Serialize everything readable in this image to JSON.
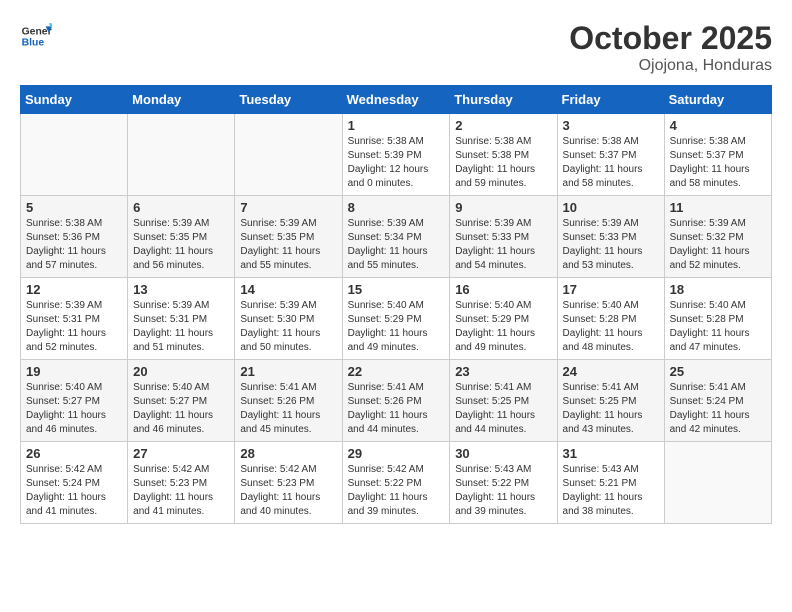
{
  "header": {
    "logo_line1": "General",
    "logo_line2": "Blue",
    "month": "October 2025",
    "location": "Ojojona, Honduras"
  },
  "days_of_week": [
    "Sunday",
    "Monday",
    "Tuesday",
    "Wednesday",
    "Thursday",
    "Friday",
    "Saturday"
  ],
  "weeks": [
    [
      {
        "day": "",
        "info": ""
      },
      {
        "day": "",
        "info": ""
      },
      {
        "day": "",
        "info": ""
      },
      {
        "day": "1",
        "info": "Sunrise: 5:38 AM\nSunset: 5:39 PM\nDaylight: 12 hours\nand 0 minutes."
      },
      {
        "day": "2",
        "info": "Sunrise: 5:38 AM\nSunset: 5:38 PM\nDaylight: 11 hours\nand 59 minutes."
      },
      {
        "day": "3",
        "info": "Sunrise: 5:38 AM\nSunset: 5:37 PM\nDaylight: 11 hours\nand 58 minutes."
      },
      {
        "day": "4",
        "info": "Sunrise: 5:38 AM\nSunset: 5:37 PM\nDaylight: 11 hours\nand 58 minutes."
      }
    ],
    [
      {
        "day": "5",
        "info": "Sunrise: 5:38 AM\nSunset: 5:36 PM\nDaylight: 11 hours\nand 57 minutes."
      },
      {
        "day": "6",
        "info": "Sunrise: 5:39 AM\nSunset: 5:35 PM\nDaylight: 11 hours\nand 56 minutes."
      },
      {
        "day": "7",
        "info": "Sunrise: 5:39 AM\nSunset: 5:35 PM\nDaylight: 11 hours\nand 55 minutes."
      },
      {
        "day": "8",
        "info": "Sunrise: 5:39 AM\nSunset: 5:34 PM\nDaylight: 11 hours\nand 55 minutes."
      },
      {
        "day": "9",
        "info": "Sunrise: 5:39 AM\nSunset: 5:33 PM\nDaylight: 11 hours\nand 54 minutes."
      },
      {
        "day": "10",
        "info": "Sunrise: 5:39 AM\nSunset: 5:33 PM\nDaylight: 11 hours\nand 53 minutes."
      },
      {
        "day": "11",
        "info": "Sunrise: 5:39 AM\nSunset: 5:32 PM\nDaylight: 11 hours\nand 52 minutes."
      }
    ],
    [
      {
        "day": "12",
        "info": "Sunrise: 5:39 AM\nSunset: 5:31 PM\nDaylight: 11 hours\nand 52 minutes."
      },
      {
        "day": "13",
        "info": "Sunrise: 5:39 AM\nSunset: 5:31 PM\nDaylight: 11 hours\nand 51 minutes."
      },
      {
        "day": "14",
        "info": "Sunrise: 5:39 AM\nSunset: 5:30 PM\nDaylight: 11 hours\nand 50 minutes."
      },
      {
        "day": "15",
        "info": "Sunrise: 5:40 AM\nSunset: 5:29 PM\nDaylight: 11 hours\nand 49 minutes."
      },
      {
        "day": "16",
        "info": "Sunrise: 5:40 AM\nSunset: 5:29 PM\nDaylight: 11 hours\nand 49 minutes."
      },
      {
        "day": "17",
        "info": "Sunrise: 5:40 AM\nSunset: 5:28 PM\nDaylight: 11 hours\nand 48 minutes."
      },
      {
        "day": "18",
        "info": "Sunrise: 5:40 AM\nSunset: 5:28 PM\nDaylight: 11 hours\nand 47 minutes."
      }
    ],
    [
      {
        "day": "19",
        "info": "Sunrise: 5:40 AM\nSunset: 5:27 PM\nDaylight: 11 hours\nand 46 minutes."
      },
      {
        "day": "20",
        "info": "Sunrise: 5:40 AM\nSunset: 5:27 PM\nDaylight: 11 hours\nand 46 minutes."
      },
      {
        "day": "21",
        "info": "Sunrise: 5:41 AM\nSunset: 5:26 PM\nDaylight: 11 hours\nand 45 minutes."
      },
      {
        "day": "22",
        "info": "Sunrise: 5:41 AM\nSunset: 5:26 PM\nDaylight: 11 hours\nand 44 minutes."
      },
      {
        "day": "23",
        "info": "Sunrise: 5:41 AM\nSunset: 5:25 PM\nDaylight: 11 hours\nand 44 minutes."
      },
      {
        "day": "24",
        "info": "Sunrise: 5:41 AM\nSunset: 5:25 PM\nDaylight: 11 hours\nand 43 minutes."
      },
      {
        "day": "25",
        "info": "Sunrise: 5:41 AM\nSunset: 5:24 PM\nDaylight: 11 hours\nand 42 minutes."
      }
    ],
    [
      {
        "day": "26",
        "info": "Sunrise: 5:42 AM\nSunset: 5:24 PM\nDaylight: 11 hours\nand 41 minutes."
      },
      {
        "day": "27",
        "info": "Sunrise: 5:42 AM\nSunset: 5:23 PM\nDaylight: 11 hours\nand 41 minutes."
      },
      {
        "day": "28",
        "info": "Sunrise: 5:42 AM\nSunset: 5:23 PM\nDaylight: 11 hours\nand 40 minutes."
      },
      {
        "day": "29",
        "info": "Sunrise: 5:42 AM\nSunset: 5:22 PM\nDaylight: 11 hours\nand 39 minutes."
      },
      {
        "day": "30",
        "info": "Sunrise: 5:43 AM\nSunset: 5:22 PM\nDaylight: 11 hours\nand 39 minutes."
      },
      {
        "day": "31",
        "info": "Sunrise: 5:43 AM\nSunset: 5:21 PM\nDaylight: 11 hours\nand 38 minutes."
      },
      {
        "day": "",
        "info": ""
      }
    ]
  ]
}
